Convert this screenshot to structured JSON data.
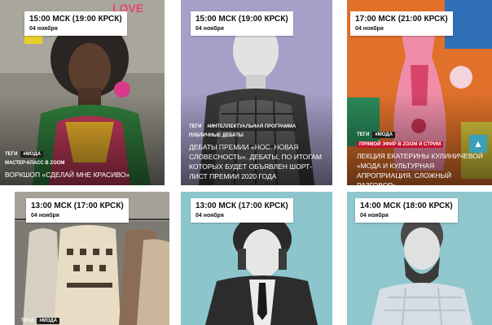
{
  "events": [
    {
      "time": "15:00 МСК (19:00 КРСК)",
      "day": "04 ноября",
      "tags_label": "ТЕГИ",
      "tag": "#МОДА",
      "category": "МАСТЕР-КЛАСС В ZOOM",
      "title": "ВОРКШОП «СДЕЛАЙ МНЕ КРАСИВО»",
      "backdrop_text": "LOVE"
    },
    {
      "time": "15:00 МСК (19:00 КРСК)",
      "day": "04 ноября",
      "tags_label": "ТЕГИ",
      "tag": "#ИНТЕЛЛЕКТУАЛЬНАЯ ПРОГРАММА",
      "category": "ПУБЛИЧНЫЕ ДЕБАТЫ",
      "title": "ДЕБАТЫ ПРЕМИИ «НОС. НОВАЯ СЛОВЕСНОСТЬ». ДЕБАТЫ, ПО ИТОГАМ КОТОРЫХ БУДЕТ ОБЪЯВЛЕН ШОРТ-ЛИСТ ПРЕМИИ 2020 ГОДА"
    },
    {
      "time": "17:00 МСК (21:00 КРСК)",
      "day": "04 ноября",
      "tags_label": "ТЕГИ",
      "tag": "#МОДА",
      "category": "ПРЯМОЙ ЭФИР В ZOOM И СТРИМ",
      "title": "ЛЕКЦИЯ ЕКАТЕРИНЫ КУЛИНИЧЕВОЙ «МОДА И КУЛЬТУРНАЯ АПРОПРИАЦИЯ. СЛОЖНЫЙ РАЗГОВОР»"
    },
    {
      "time": "13:00 МСК (17:00 КРСК)",
      "day": "04 ноября",
      "tags_label": "ТЕГИ",
      "tag": "#МОДА"
    },
    {
      "time": "13:00 МСК (17:00 КРСК)",
      "day": "04 ноября"
    },
    {
      "time": "14:00 МСК (18:00 КРСК)",
      "day": "04 ноября"
    }
  ],
  "icons": {
    "scroll_up": "arrow-up-icon"
  },
  "colors": {
    "accent_red": "#c4122f",
    "scroll_button": "#3aa0b8"
  }
}
